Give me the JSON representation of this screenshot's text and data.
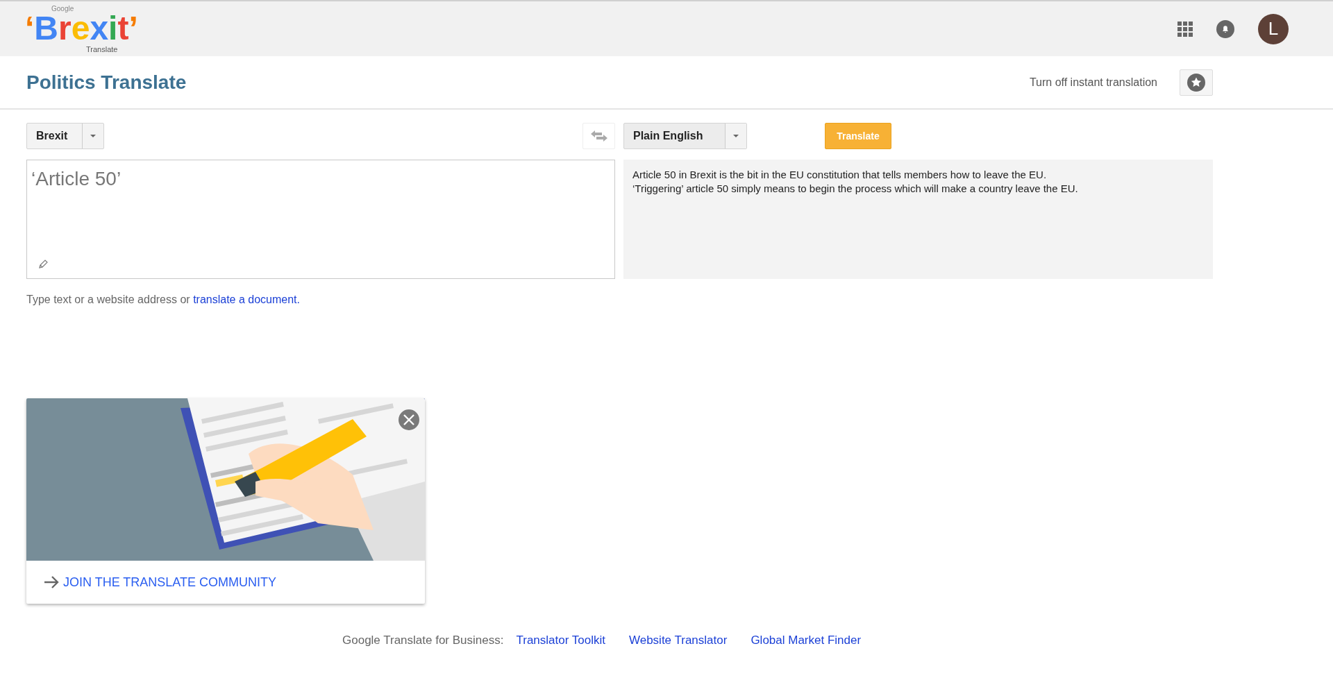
{
  "logo": {
    "small_brand": "Google",
    "subtitle": "Translate",
    "letters": [
      {
        "char": "‘",
        "color": "#f57c00"
      },
      {
        "char": "B",
        "color": "#4285f4"
      },
      {
        "char": "r",
        "color": "#ea4335"
      },
      {
        "char": "e",
        "color": "#fbbc05"
      },
      {
        "char": "x",
        "color": "#4285f4"
      },
      {
        "char": "i",
        "color": "#34a853"
      },
      {
        "char": "t",
        "color": "#ea4335"
      },
      {
        "char": "’",
        "color": "#f57c00"
      }
    ]
  },
  "account": {
    "avatar_letter": "L"
  },
  "page_title": "Politics Translate",
  "instant_toggle": "Turn off instant translation",
  "source_language": "Brexit",
  "target_language": "Plain English",
  "translate_button": "Translate",
  "source_text": "‘Article 50’",
  "translation_lines": [
    "Article 50 in Brexit is the bit in the EU constitution that tells members how to leave the EU.",
    "‘Triggering’ article 50 simply means to begin the process which will make a country leave the EU."
  ],
  "hint": {
    "text": "Type text or a website address or",
    "link": "translate a document."
  },
  "community_card": {
    "link": "JOIN THE TRANSLATE COMMUNITY"
  },
  "footer": {
    "label": "Google Translate for Business:",
    "links": [
      "Translator Toolkit",
      "Website Translator",
      "Global Market Finder"
    ]
  }
}
